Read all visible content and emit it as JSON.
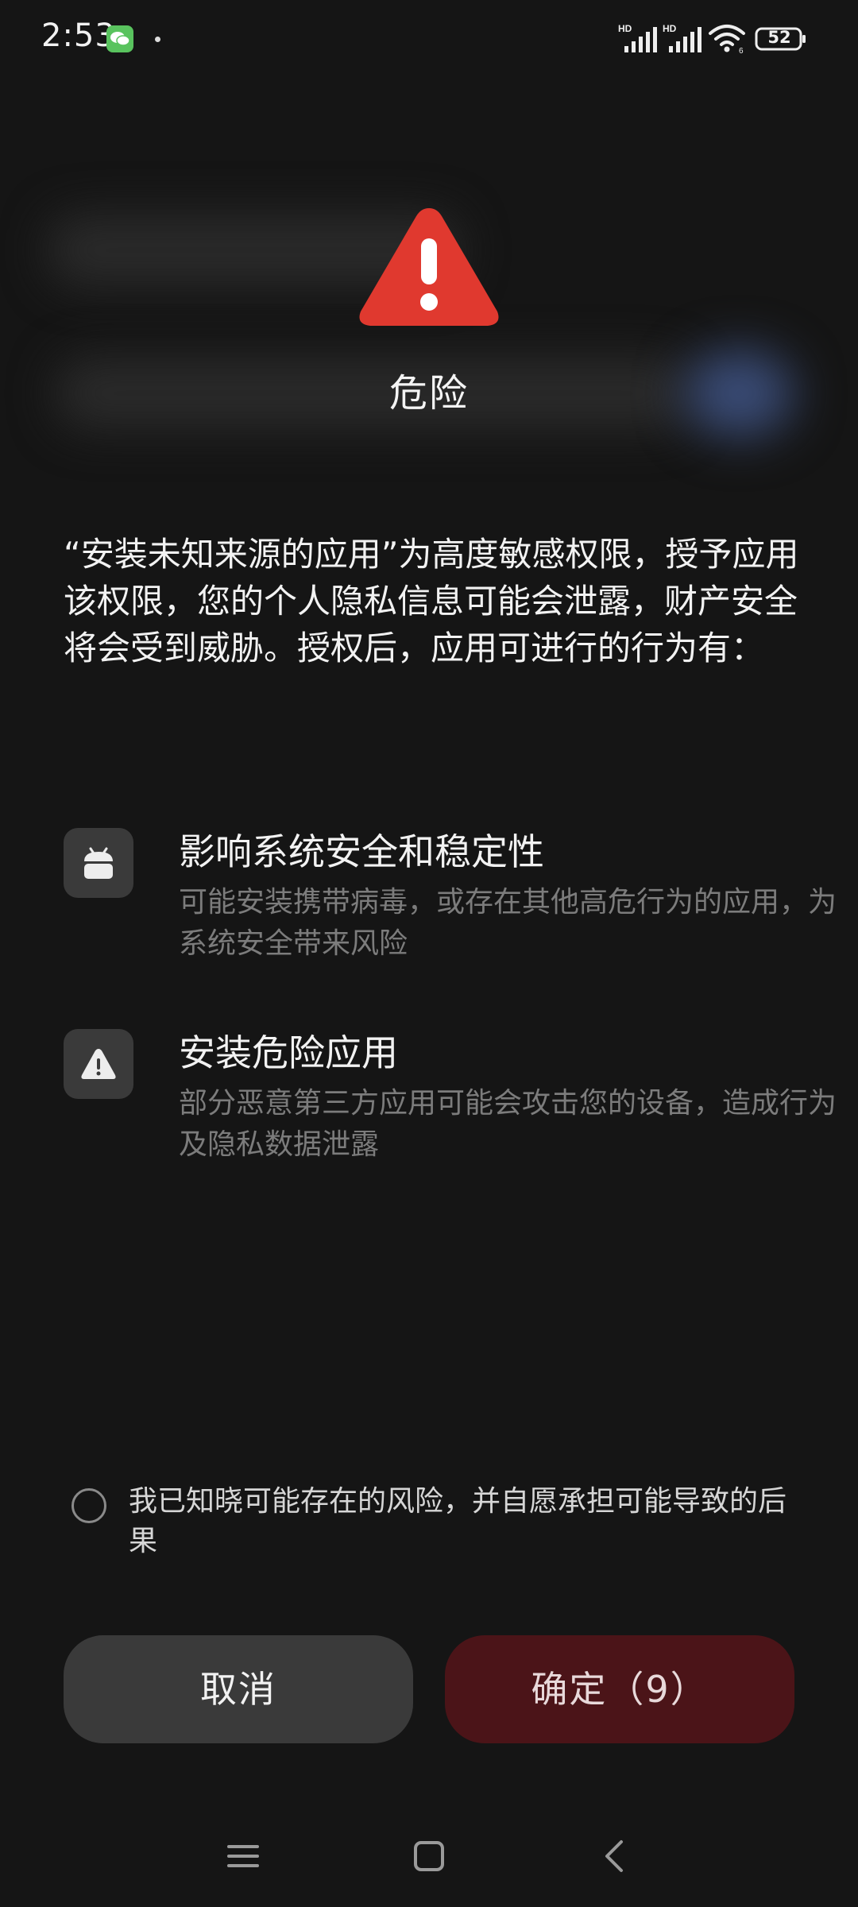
{
  "status_bar": {
    "time": "2:53",
    "battery": "52",
    "icons": [
      "wechat-icon",
      "hd-signal-icon",
      "hd-signal-icon",
      "wifi-icon",
      "battery-icon"
    ]
  },
  "dialog": {
    "title": "危险",
    "description": "“安装未知来源的应用”为高度敏感权限，授予应用该权限，您的个人隐私信息可能会泄露，财产安全将会受到威胁。授权后，应用可进行的行为有：",
    "behaviors": [
      {
        "icon": "android-icon",
        "title": "影响系统安全和稳定性",
        "desc": "可能安装携带病毒，或存在其他高危行为的应用，为系统安全带来风险"
      },
      {
        "icon": "warning-triangle-icon",
        "title": "安装危险应用",
        "desc": "部分恶意第三方应用可能会攻击您的设备，造成行为及隐私数据泄露"
      }
    ],
    "consent": "我已知晓可能存在的风险，并自愿承担可能导致的后果",
    "cancel_label": "取消",
    "confirm_label": "确定（9）"
  },
  "colors": {
    "background": "#151515",
    "danger": "#e0392f",
    "confirm_bg": "#4b1418",
    "cancel_bg": "#3a3a3a",
    "secondary_text": "#7c7c7c"
  },
  "nav": {
    "icons": [
      "menu-icon",
      "home-icon",
      "back-icon"
    ]
  }
}
